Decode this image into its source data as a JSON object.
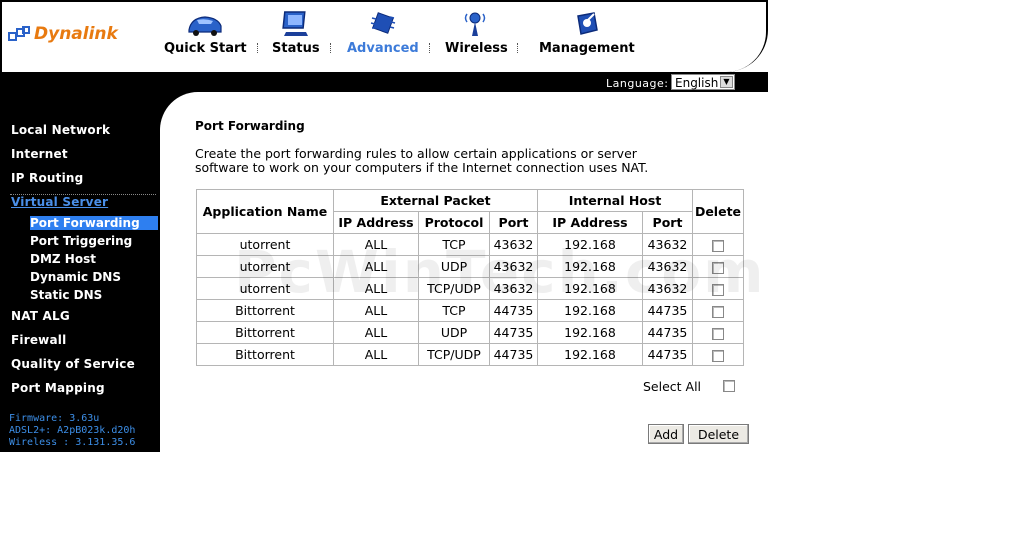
{
  "brand": {
    "name": "Dynalink",
    "color": "#e87a10"
  },
  "nav": [
    {
      "label": "Quick Start",
      "icon": "car-icon",
      "active": false
    },
    {
      "label": "Status",
      "icon": "monitor-icon",
      "active": false
    },
    {
      "label": "Advanced",
      "icon": "chip-icon",
      "active": true
    },
    {
      "label": "Wireless",
      "icon": "antenna-icon",
      "active": false
    },
    {
      "label": "Management",
      "icon": "box-icon",
      "active": false
    }
  ],
  "language": {
    "label": "Language:",
    "value": "English"
  },
  "sidebar": {
    "items": [
      {
        "label": "Local Network"
      },
      {
        "label": "Internet"
      },
      {
        "label": "IP Routing"
      },
      {
        "label": "Virtual Server",
        "active": true
      },
      {
        "label": "NAT ALG"
      },
      {
        "label": "Firewall"
      },
      {
        "label": "Quality of Service"
      },
      {
        "label": "Port Mapping"
      }
    ],
    "subitems": [
      {
        "label": "Port Forwarding",
        "active": true
      },
      {
        "label": "Port Triggering"
      },
      {
        "label": "DMZ Host"
      },
      {
        "label": "Dynamic DNS"
      },
      {
        "label": "Static DNS"
      }
    ],
    "info": {
      "firmware": "Firmware:  3.63u",
      "adsl": "ADSL2+:  A2pB023k.d20h",
      "wireless": "Wireless :  3.131.35.6"
    }
  },
  "main": {
    "title": "Port Forwarding",
    "description_1": "Create the port forwarding rules to allow certain applications or server",
    "description_2": "software to work on your computers if the Internet connection uses NAT.",
    "table": {
      "headers": {
        "app": "Application Name",
        "external": "External Packet",
        "internal": "Internal Host",
        "delete": "Delete",
        "ip": "IP Address",
        "protocol": "Protocol",
        "port": "Port",
        "iip": "IP Address",
        "iport": "Port"
      },
      "rows": [
        {
          "app": "utorrent",
          "ip": "ALL",
          "protocol": "TCP",
          "port": "43632",
          "iip": "192.168",
          "iport": "43632"
        },
        {
          "app": "utorrent",
          "ip": "ALL",
          "protocol": "UDP",
          "port": "43632",
          "iip": "192.168",
          "iport": "43632"
        },
        {
          "app": "utorrent",
          "ip": "ALL",
          "protocol": "TCP/UDP",
          "port": "43632",
          "iip": "192.168",
          "iport": "43632"
        },
        {
          "app": "Bittorrent",
          "ip": "ALL",
          "protocol": "TCP",
          "port": "44735",
          "iip": "192.168",
          "iport": "44735"
        },
        {
          "app": "Bittorrent",
          "ip": "ALL",
          "protocol": "UDP",
          "port": "44735",
          "iip": "192.168",
          "iport": "44735"
        },
        {
          "app": "Bittorrent",
          "ip": "ALL",
          "protocol": "TCP/UDP",
          "port": "44735",
          "iip": "192.168",
          "iport": "44735"
        }
      ]
    },
    "select_all_label": "Select All",
    "add_label": "Add",
    "delete_label": "Delete"
  },
  "watermark": "PcWinTech.com",
  "colors": {
    "accent": "#3d7bd9",
    "selected": "#2e7ff0",
    "sidebar_bg": "#000000"
  }
}
